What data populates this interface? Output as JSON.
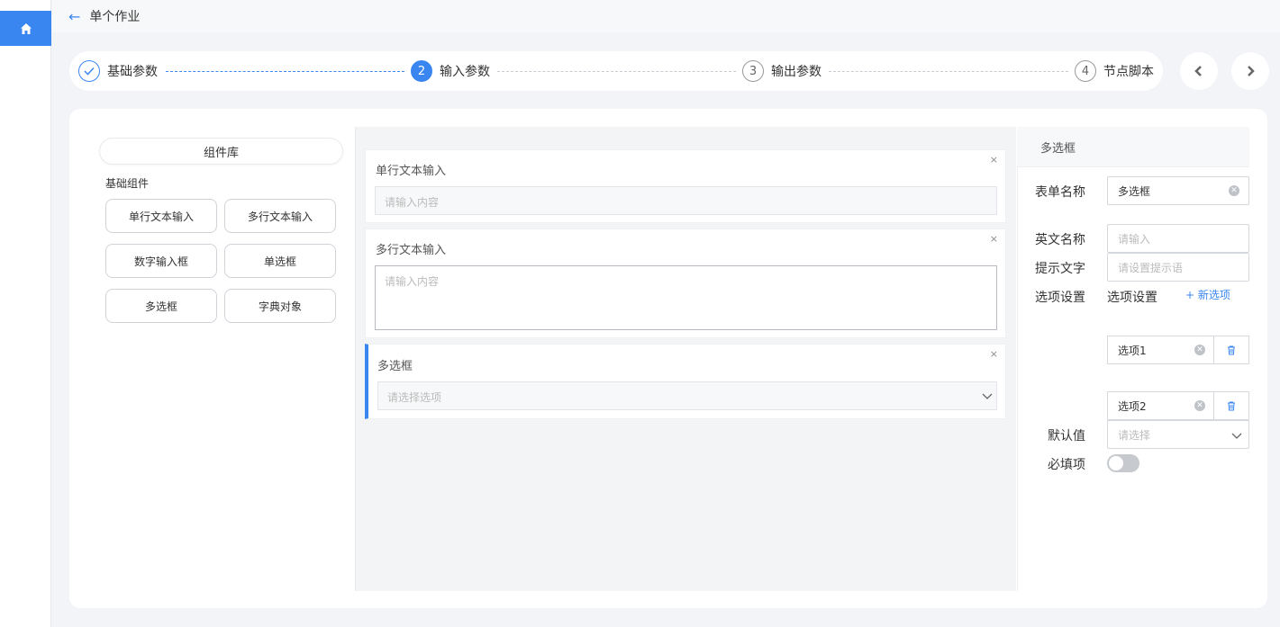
{
  "header": {
    "title": "单个作业"
  },
  "steps": [
    {
      "label": "基础参数",
      "number": "",
      "state": "done"
    },
    {
      "label": "输入参数",
      "number": "2",
      "state": "active"
    },
    {
      "label": "输出参数",
      "number": "3",
      "state": "pending"
    },
    {
      "label": "节点脚本",
      "number": "4",
      "state": "pending"
    }
  ],
  "library": {
    "title": "组件库",
    "subtitle": "基础组件",
    "components": [
      "单行文本输入",
      "多行文本输入",
      "数字输入框",
      "单选框",
      "多选框",
      "字典对象"
    ]
  },
  "canvas": {
    "fields": [
      {
        "label": "单行文本输入",
        "placeholder": "请输入内容",
        "close": "×"
      },
      {
        "label": "多行文本输入",
        "placeholder": "请输入内容",
        "close": "×"
      },
      {
        "label": "多选框",
        "placeholder": "请选择选项",
        "close": "×"
      }
    ]
  },
  "properties": {
    "header": "多选框",
    "form_name_label": "表单名称",
    "form_name_value": "多选框",
    "en_name_label": "英文名称",
    "en_name_placeholder": "请输入",
    "hint_label": "提示文字",
    "hint_placeholder": "请设置提示语",
    "options_label": "选项设置",
    "options_sub_label": "选项设置",
    "add_option": "+ 新选项",
    "options": [
      "选项1",
      "选项2"
    ],
    "default_label": "默认值",
    "default_placeholder": "请选择",
    "required_label": "必填项",
    "required": false
  },
  "colors": {
    "accent": "#3a86f0",
    "background": "#f3f4f7"
  },
  "icons": [
    "home-icon",
    "back-arrow-icon",
    "check-icon",
    "chevron-left-icon",
    "chevron-right-icon",
    "close-icon",
    "chevron-down-icon",
    "clear-icon",
    "trash-icon"
  ]
}
